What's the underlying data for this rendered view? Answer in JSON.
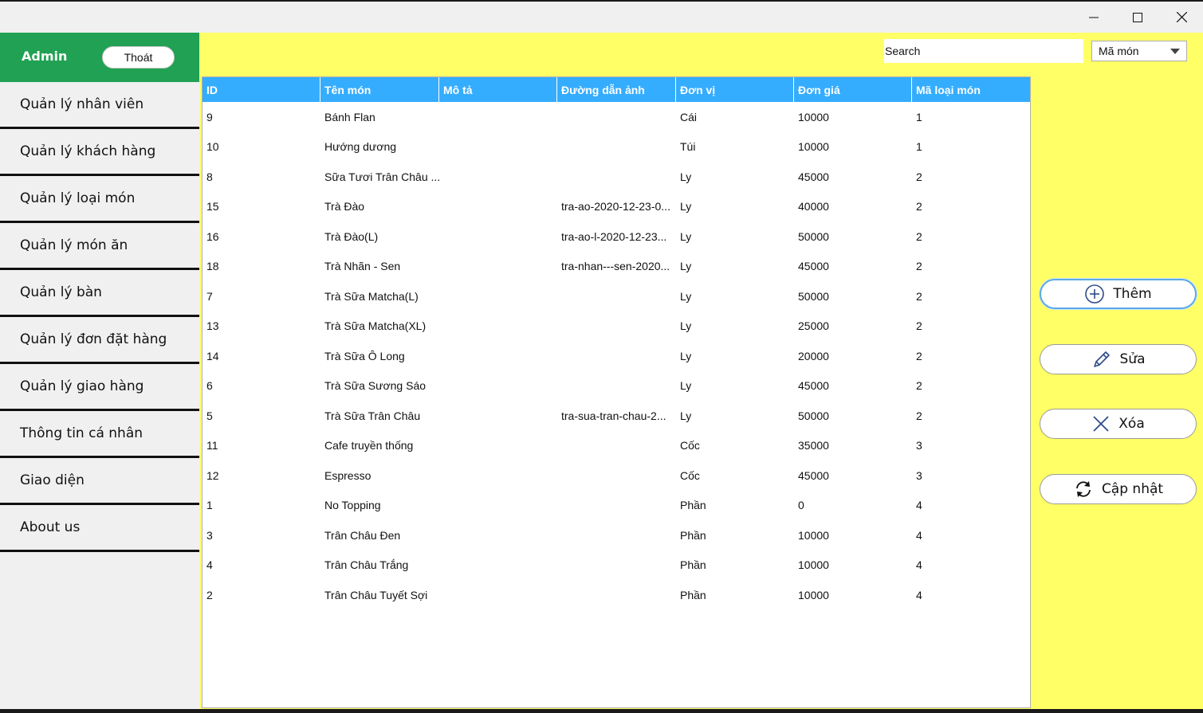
{
  "window": {
    "controls": {
      "minimize": "minimize-icon",
      "maximize": "maximize-icon",
      "close": "close-icon"
    }
  },
  "sidebar": {
    "user": "Admin",
    "logout_label": "Thoát",
    "items": [
      {
        "label": "Quản lý nhân viên"
      },
      {
        "label": "Quản lý khách hàng"
      },
      {
        "label": "Quản lý loại món"
      },
      {
        "label": "Quản lý món ăn"
      },
      {
        "label": "Quản lý bàn"
      },
      {
        "label": "Quản lý đơn đặt hàng"
      },
      {
        "label": "Quản lý giao hàng"
      },
      {
        "label": "Thông tin cá nhân"
      },
      {
        "label": "Giao diện"
      },
      {
        "label": "About us"
      }
    ]
  },
  "search": {
    "value": "Search",
    "filter_selected": "Mã món"
  },
  "table": {
    "columns": [
      "ID",
      "Tên món",
      "Mô tả",
      "Đường dẫn ảnh",
      "Đơn vị",
      "Đơn giá",
      "Mã loại món"
    ],
    "rows": [
      [
        "9",
        "Bánh Flan",
        "",
        "",
        "Cái",
        "10000",
        "1"
      ],
      [
        "10",
        "Hướng dương",
        "",
        "",
        "Túi",
        "10000",
        "1"
      ],
      [
        "8",
        "Sữa Tươi Trân Châu ...",
        "",
        "",
        "Ly",
        "45000",
        "2"
      ],
      [
        "15",
        "Trà Đào",
        "",
        "tra-ao-2020-12-23-0...",
        "Ly",
        "40000",
        "2"
      ],
      [
        "16",
        "Trà Đào(L)",
        "",
        "tra-ao-l-2020-12-23...",
        "Ly",
        "50000",
        "2"
      ],
      [
        "18",
        "Trà Nhãn - Sen",
        "",
        "tra-nhan---sen-2020...",
        "Ly",
        "45000",
        "2"
      ],
      [
        "7",
        "Trà Sữa Matcha(L)",
        "",
        "",
        "Ly",
        "50000",
        "2"
      ],
      [
        "13",
        "Trà Sữa Matcha(XL)",
        "",
        "",
        "Ly",
        "25000",
        "2"
      ],
      [
        "14",
        "Trà Sữa Ô Long",
        "",
        "",
        "Ly",
        "20000",
        "2"
      ],
      [
        "6",
        "Trà Sữa Sương Sáo",
        "",
        "",
        "Ly",
        "45000",
        "2"
      ],
      [
        "5",
        "Trà Sữa Trân Châu",
        "",
        "tra-sua-tran-chau-2...",
        "Ly",
        "50000",
        "2"
      ],
      [
        "11",
        "Cafe truyền thống",
        "",
        "",
        "Cốc",
        "35000",
        "3"
      ],
      [
        "12",
        "Espresso",
        "",
        "",
        "Cốc",
        "45000",
        "3"
      ],
      [
        "1",
        "No Topping",
        "",
        "",
        "Phần",
        "0",
        "4"
      ],
      [
        "3",
        "Trân Châu Đen",
        "",
        "",
        "Phần",
        "10000",
        "4"
      ],
      [
        "4",
        "Trân Châu Trắng",
        "",
        "",
        "Phần",
        "10000",
        "4"
      ],
      [
        "2",
        "Trân Châu Tuyết Sợi",
        "",
        "",
        "Phần",
        "10000",
        "4"
      ]
    ]
  },
  "actions": {
    "add_label": "Thêm",
    "edit_label": "Sửa",
    "delete_label": "Xóa",
    "refresh_label": "Cập nhật"
  },
  "colors": {
    "sidebar_header": "#21a153",
    "main_background": "#ffff66",
    "table_header": "#35adff"
  }
}
